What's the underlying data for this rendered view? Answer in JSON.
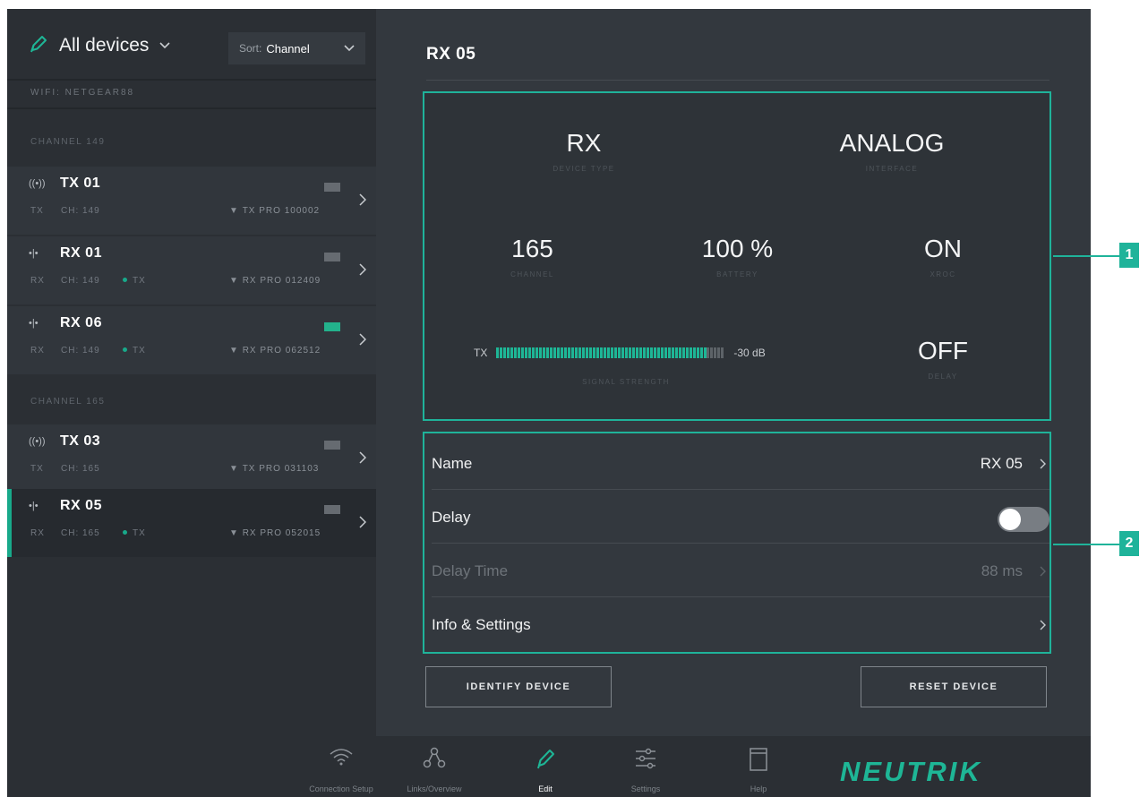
{
  "sidebar": {
    "device_filter": "All devices",
    "sort_prefix": "Sort:",
    "sort_value": "Channel",
    "wifi_label": "WIFI: NETGEAR88",
    "groups": [
      {
        "heading": "CHANNEL 149",
        "devices": [
          {
            "name": "TX 01",
            "type": "TX",
            "channel": "CH: 149",
            "link": "",
            "model": "TX PRO 100002",
            "battery_color": "#666b71",
            "icon": "transmitter-icon"
          },
          {
            "name": "RX 01",
            "type": "RX",
            "channel": "CH: 149",
            "link": "TX",
            "model": "RX PRO 012409",
            "battery_color": "#666b71",
            "icon": "receiver-icon"
          },
          {
            "name": "RX 06",
            "type": "RX",
            "channel": "CH: 149",
            "link": "TX",
            "model": "RX PRO 062512",
            "battery_color": "#23b28c",
            "icon": "receiver-icon"
          }
        ]
      },
      {
        "heading": "CHANNEL 165",
        "devices": [
          {
            "name": "TX 03",
            "type": "TX",
            "channel": "CH: 165",
            "link": "",
            "model": "TX PRO 031103",
            "battery_color": "#666b71",
            "icon": "transmitter-icon"
          },
          {
            "name": "RX 05",
            "type": "RX",
            "channel": "CH: 165",
            "link": "TX",
            "model": "RX PRO 052015",
            "battery_color": "#666b71",
            "icon": "receiver-icon",
            "selected": true
          }
        ]
      }
    ]
  },
  "main": {
    "title": "RX 05",
    "stats": {
      "device_type": {
        "value": "RX",
        "label": "DEVICE TYPE"
      },
      "interface": {
        "value": "ANALOG",
        "label": "INTERFACE"
      },
      "channel": {
        "value": "165",
        "label": "CHANNEL"
      },
      "battery": {
        "value": "100 %",
        "label": "BATTERY"
      },
      "xroc": {
        "value": "ON",
        "label": "XROC"
      },
      "signal": {
        "prefix": "TX",
        "level_fraction": 0.92,
        "value": "-30 dB",
        "label": "SIGNAL STRENGTH"
      },
      "delay": {
        "value": "OFF",
        "label": "DELAY"
      }
    },
    "settings": [
      {
        "label": "Name",
        "value": "RX 05"
      },
      {
        "label": "Delay",
        "toggle_on": false
      },
      {
        "label": "Delay Time",
        "value": "88 ms"
      },
      {
        "label": "Info & Settings",
        "value": ""
      }
    ],
    "identify_button": "IDENTIFY DEVICE",
    "reset_button": "RESET DEVICE"
  },
  "bottom_nav": {
    "items": [
      {
        "label": "Connection Setup",
        "icon": "wifi-icon"
      },
      {
        "label": "Links/Overview",
        "icon": "links-icon"
      },
      {
        "label": "Edit",
        "icon": "pencil-icon",
        "active": true
      },
      {
        "label": "Settings",
        "icon": "sliders-icon"
      },
      {
        "label": "Help",
        "icon": "book-icon"
      }
    ],
    "logo": "NEUTRIK"
  },
  "callouts": [
    "1",
    "2"
  ],
  "colors": {
    "accent": "#1fb39a",
    "background": "#2b2f34",
    "panel": "#33383e"
  }
}
